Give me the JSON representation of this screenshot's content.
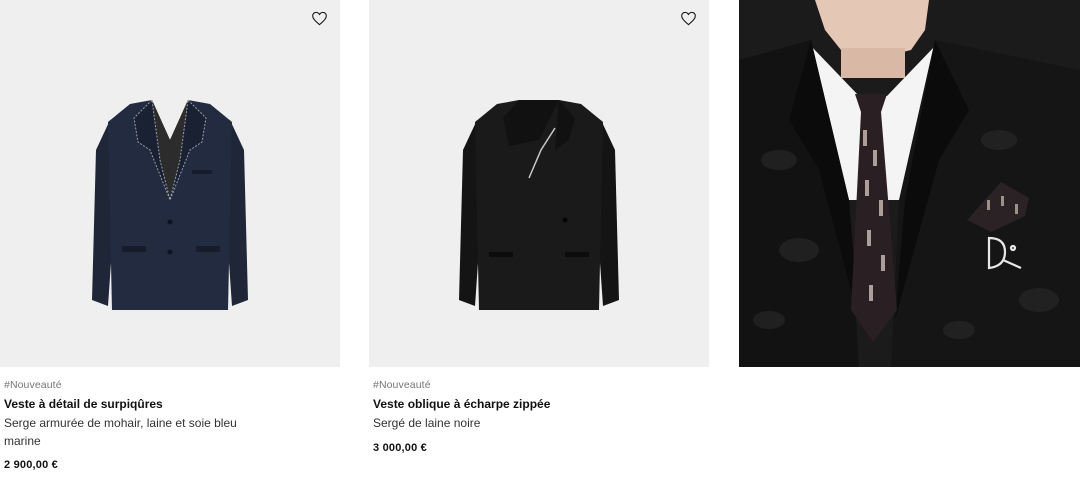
{
  "products": [
    {
      "badge": "#Nouveauté",
      "title": "Veste à détail de surpiqûres",
      "description": "Serge armurée de mohair, laine et soie bleu marine",
      "price": "2 900,00 €",
      "image_icon": "navy-jacket-image",
      "wishlist_icon": "heart-icon"
    },
    {
      "badge": "#Nouveauté",
      "title": "Veste oblique à écharpe zippée",
      "description": "Sergé de laine noire",
      "price": "3 000,00 €",
      "image_icon": "black-jacket-image",
      "wishlist_icon": "heart-icon"
    },
    {
      "image_icon": "model-lookbook-image"
    }
  ],
  "colors": {
    "image_background": "#efefef",
    "navy_jacket": "#1e2638",
    "black_jacket": "#151515",
    "text_primary": "#111111",
    "badge_grey": "#777777"
  }
}
